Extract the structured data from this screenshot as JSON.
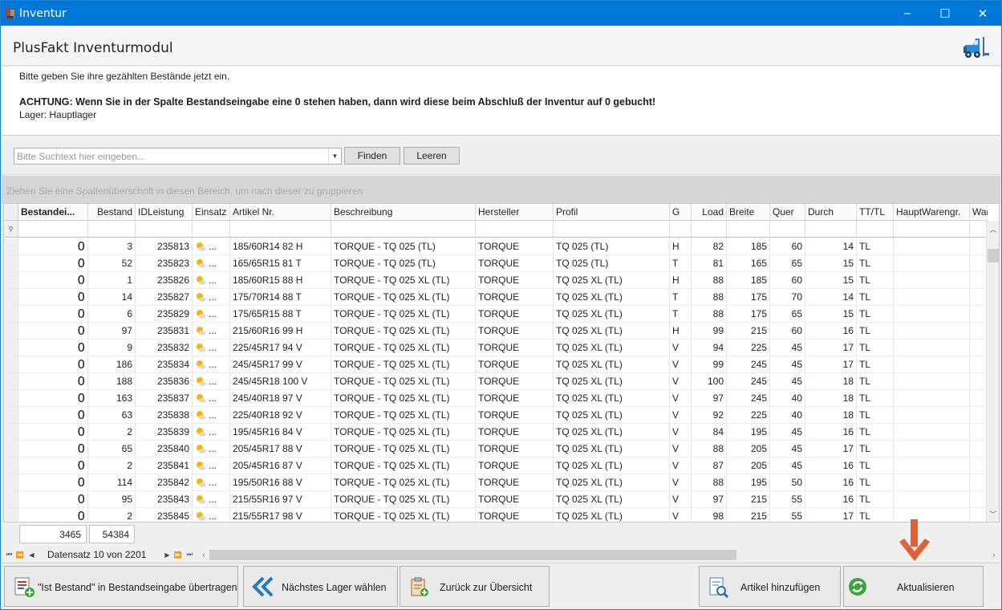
{
  "window": {
    "title": "Inventur",
    "minimize_glyph": "–",
    "maximize_glyph": "☐",
    "close_glyph": "✕"
  },
  "header": {
    "title": "PlusFakt Inventurmodul",
    "logo_icon": "forklift-icon"
  },
  "info": {
    "line1": "Bitte geben Sie ihre gezählten Bestände jetzt ein.",
    "warning": "ACHTUNG: Wenn Sie in der Spalte Bestandseingabe eine 0 stehen haben, dann wird diese beim Abschluß der Inventur auf 0 gebucht!",
    "lager": "Lager: Hauptlager"
  },
  "search": {
    "placeholder": "Bitte Suchtext hier eingeben...",
    "find_label": "Finden",
    "clear_label": "Leeren"
  },
  "group_panel_hint": "Ziehen Sie eine Spaltenüberschrift in diesen Bereich, um nach dieser zu gruppieren",
  "grid": {
    "columns": [
      "Bestandei...",
      "Bestand",
      "IDLeistung",
      "Einsatz",
      "Artikel Nr.",
      "Beschreibung",
      "Hersteller",
      "Profil",
      "G",
      "Load",
      "Breite",
      "Quer",
      "Durch",
      "TT/TL",
      "HauptWarengr.",
      "Waren"
    ],
    "einsatz_text": "...",
    "rows": [
      [
        "0",
        "3",
        "235813",
        "185/60R14 82 H",
        "TORQUE - TQ 025 (TL)",
        "TORQUE",
        "TQ 025 (TL)",
        "H",
        "82",
        "185",
        "60",
        "14",
        "TL"
      ],
      [
        "0",
        "52",
        "235823",
        "165/65R15 81 T",
        "TORQUE - TQ 025 (TL)",
        "TORQUE",
        "TQ 025 (TL)",
        "T",
        "81",
        "165",
        "65",
        "15",
        "TL"
      ],
      [
        "0",
        "1",
        "235826",
        "185/60R15 88 H",
        "TORQUE - TQ 025 XL (TL)",
        "TORQUE",
        "TQ 025 XL (TL)",
        "H",
        "88",
        "185",
        "60",
        "15",
        "TL"
      ],
      [
        "0",
        "14",
        "235827",
        "175/70R14 88 T",
        "TORQUE - TQ 025 XL (TL)",
        "TORQUE",
        "TQ 025 XL (TL)",
        "T",
        "88",
        "175",
        "70",
        "14",
        "TL"
      ],
      [
        "0",
        "6",
        "235829",
        "175/65R15 88 T",
        "TORQUE - TQ 025 XL (TL)",
        "TORQUE",
        "TQ 025 XL (TL)",
        "T",
        "88",
        "175",
        "65",
        "15",
        "TL"
      ],
      [
        "0",
        "97",
        "235831",
        "215/60R16 99 H",
        "TORQUE - TQ 025 XL (TL)",
        "TORQUE",
        "TQ 025 XL (TL)",
        "H",
        "99",
        "215",
        "60",
        "16",
        "TL"
      ],
      [
        "0",
        "9",
        "235832",
        "225/45R17 94 V",
        "TORQUE - TQ 025 XL (TL)",
        "TORQUE",
        "TQ 025 XL (TL)",
        "V",
        "94",
        "225",
        "45",
        "17",
        "TL"
      ],
      [
        "0",
        "186",
        "235834",
        "245/45R17 99 V",
        "TORQUE - TQ 025 XL (TL)",
        "TORQUE",
        "TQ 025 XL (TL)",
        "V",
        "99",
        "245",
        "45",
        "17",
        "TL"
      ],
      [
        "0",
        "188",
        "235836",
        "245/45R18 100 V",
        "TORQUE - TQ 025 XL (TL)",
        "TORQUE",
        "TQ 025 XL (TL)",
        "V",
        "100",
        "245",
        "45",
        "18",
        "TL"
      ],
      [
        "0",
        "163",
        "235837",
        "245/40R18 97 V",
        "TORQUE - TQ 025 XL (TL)",
        "TORQUE",
        "TQ 025 XL (TL)",
        "V",
        "97",
        "245",
        "40",
        "18",
        "TL"
      ],
      [
        "0",
        "63",
        "235838",
        "225/40R18 92 V",
        "TORQUE - TQ 025 XL (TL)",
        "TORQUE",
        "TQ 025 XL (TL)",
        "V",
        "92",
        "225",
        "40",
        "18",
        "TL"
      ],
      [
        "0",
        "2",
        "235839",
        "195/45R16 84 V",
        "TORQUE - TQ 025 XL (TL)",
        "TORQUE",
        "TQ 025 XL (TL)",
        "V",
        "84",
        "195",
        "45",
        "16",
        "TL"
      ],
      [
        "0",
        "65",
        "235840",
        "205/45R17 88 V",
        "TORQUE - TQ 025 XL (TL)",
        "TORQUE",
        "TQ 025 XL (TL)",
        "V",
        "88",
        "205",
        "45",
        "17",
        "TL"
      ],
      [
        "0",
        "2",
        "235841",
        "205/45R16 87 V",
        "TORQUE - TQ 025 XL (TL)",
        "TORQUE",
        "TQ 025 XL (TL)",
        "V",
        "87",
        "205",
        "45",
        "16",
        "TL"
      ],
      [
        "0",
        "114",
        "235842",
        "195/50R16 88 V",
        "TORQUE - TQ 025 XL (TL)",
        "TORQUE",
        "TQ 025 XL (TL)",
        "V",
        "88",
        "195",
        "50",
        "16",
        "TL"
      ],
      [
        "0",
        "95",
        "235843",
        "215/55R16 97 V",
        "TORQUE - TQ 025 XL (TL)",
        "TORQUE",
        "TQ 025 XL (TL)",
        "V",
        "97",
        "215",
        "55",
        "16",
        "TL"
      ],
      [
        "0",
        "2",
        "235845",
        "215/55R17 98 V",
        "TORQUE - TQ 025 XL (TL)",
        "TORQUE",
        "TQ 025 XL (TL)",
        "V",
        "98",
        "215",
        "55",
        "17",
        "TL"
      ]
    ]
  },
  "sums": {
    "bestandseingabe": "3465",
    "bestand": "54384"
  },
  "navigator": {
    "record_text": "Datensatz 10 von 2201"
  },
  "actions": {
    "transfer_label": "\"Ist Bestand\" in Bestandseingabe übertragen",
    "next_store_label": "Nächstes Lager wählen",
    "back_label": "Zurück zur Übersicht",
    "add_article_label": "Artikel hinzufügen",
    "refresh_label": "Aktualisieren"
  },
  "colors": {
    "titlebar": "#0078d7",
    "annotation_arrow": "#e2603a",
    "next_store_icon": "#1f78c8"
  }
}
